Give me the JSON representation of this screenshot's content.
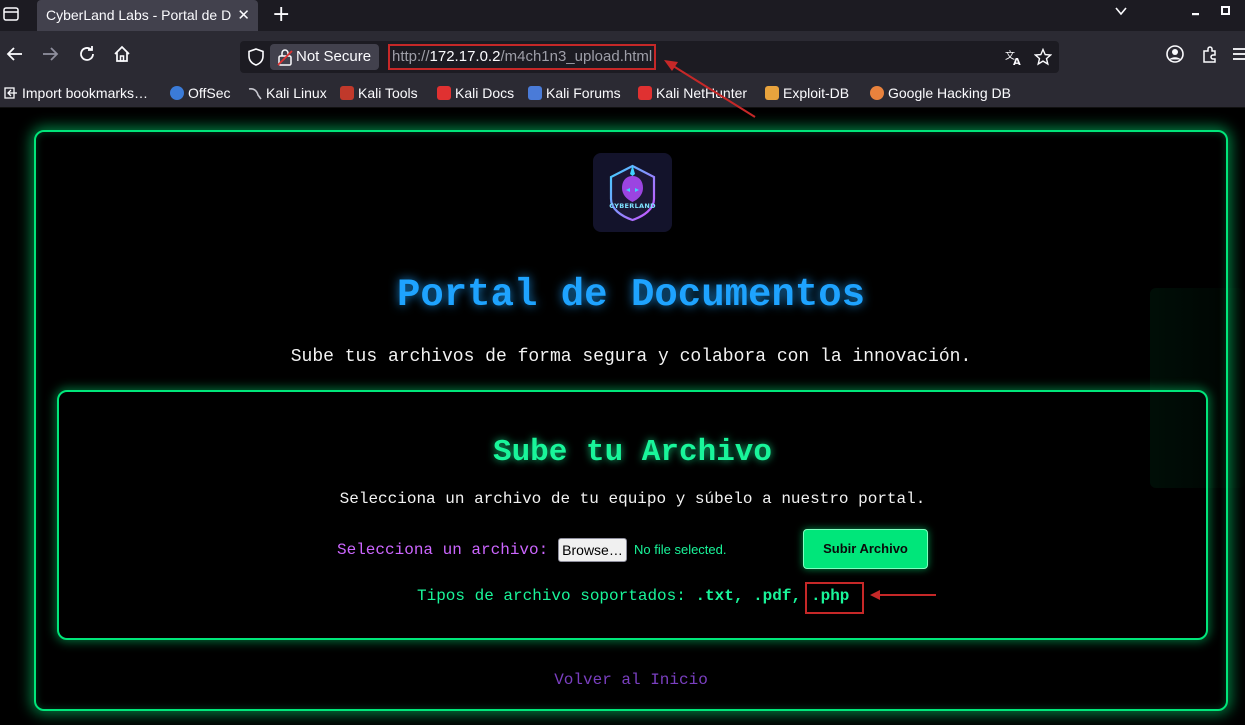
{
  "browser": {
    "tab_title": "CyberLand Labs - Portal de D",
    "tab_close": "✕",
    "new_tab": "+",
    "security_label": "Not Secure",
    "url_scheme": "http://",
    "url_host": "172.17.0.2",
    "url_path": "/m4ch1n3_upload.html",
    "bookmarks": [
      {
        "label": "Import bookmarks…",
        "color": "#fbfbfe"
      },
      {
        "label": "OffSec",
        "color": "#3b7bd8"
      },
      {
        "label": "Kali Linux",
        "color": "#8f8f9d"
      },
      {
        "label": "Kali Tools",
        "color": "#c0392b"
      },
      {
        "label": "Kali Docs",
        "color": "#e03131"
      },
      {
        "label": "Kali Forums",
        "color": "#4a7bd8"
      },
      {
        "label": "Kali NetHunter",
        "color": "#e03131"
      },
      {
        "label": "Exploit-DB",
        "color": "#e8a33d"
      },
      {
        "label": "Google Hacking DB",
        "color": "#e8823d"
      }
    ]
  },
  "page": {
    "logo_text": "CYBERLAND",
    "title": "Portal de Documentos",
    "subtitle": "Sube tus archivos de forma segura y colabora con la innovación.",
    "card": {
      "title": "Sube tu Archivo",
      "description": "Selecciona un archivo de tu equipo y súbelo a nuestro portal.",
      "file_label": "Selecciona un archivo:",
      "browse_label": "Browse…",
      "no_file_text": "No file selected.",
      "submit_label": "Subir Archivo",
      "types_label": "Tipos de archivo soportados:",
      "types_list": ".txt, .pdf,",
      "types_highlight": ".php"
    },
    "back_link": "Volver al Inicio"
  },
  "colors": {
    "accent_green": "#00e67a",
    "title_blue": "#1ea3ff",
    "label_purple": "#cc66ff",
    "link_purple": "#7a3fc0",
    "annotation_red": "#c62828"
  }
}
